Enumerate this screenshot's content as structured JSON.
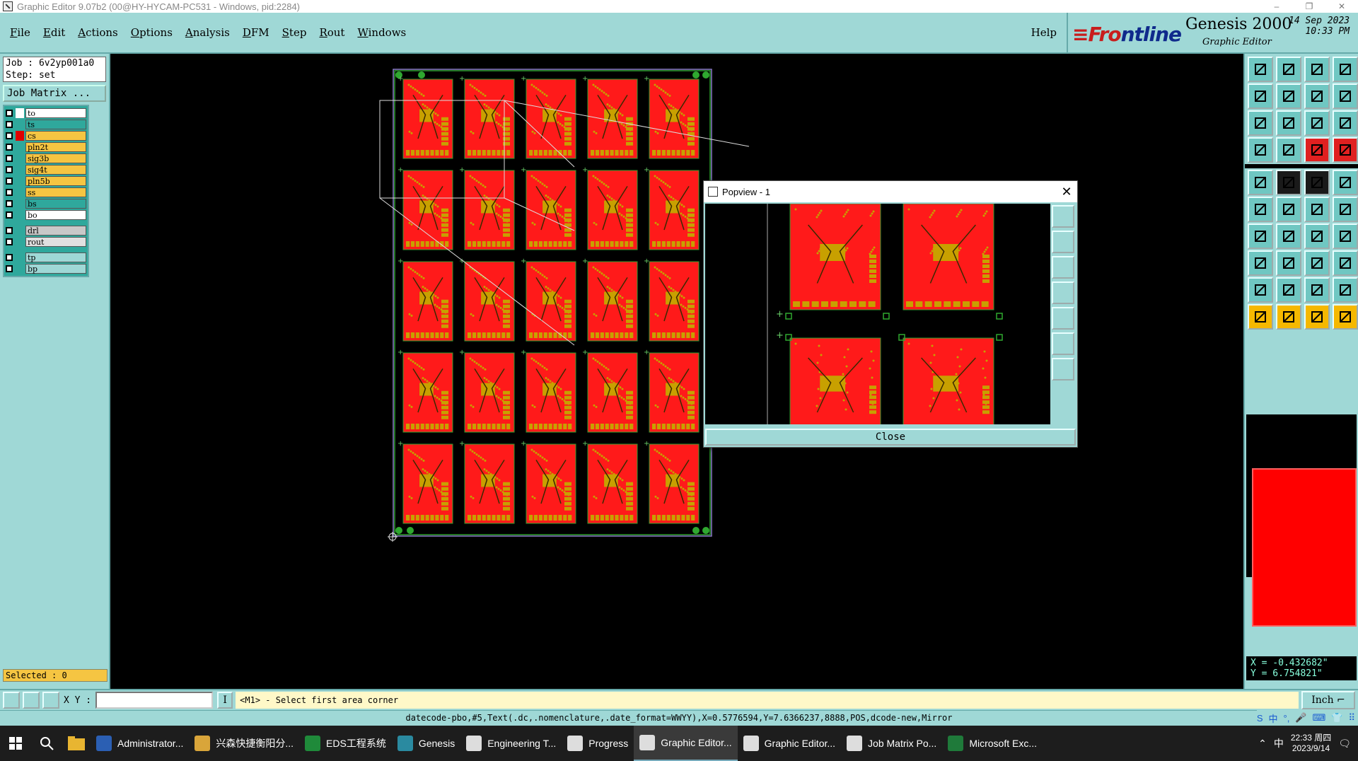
{
  "window": {
    "title": "Graphic Editor 9.07b2 (00@HY-HYCAM-PC531 - Windows, pid:2284)",
    "controls": [
      "–",
      "❐",
      "✕"
    ]
  },
  "menu": {
    "items": [
      "File",
      "Edit",
      "Actions",
      "Options",
      "Analysis",
      "DFM",
      "Step",
      "Rout",
      "Windows"
    ],
    "help": "Help"
  },
  "brand": {
    "logo_part1": "≡Fr",
    "logo_part2": "ntline",
    "logo_o": "o",
    "product": "Genesis 2000",
    "subtitle": "Graphic Editor",
    "date_line1": "14 Sep 2023",
    "date_line2": "10:33 PM"
  },
  "job": {
    "job_line": "Job : 6v2yp001a0",
    "step_line": "Step: set",
    "matrix_button": "Job Matrix ..."
  },
  "layers": [
    {
      "name": "to",
      "swatch": "#ffffff",
      "bg": "#ffffff",
      "active": false,
      "gap": false
    },
    {
      "name": "ts",
      "swatch": "#2fa89c",
      "bg": "#2fa89c",
      "active": false,
      "gap": false
    },
    {
      "name": "cs",
      "swatch": "#e00000",
      "bg": "#f5c542",
      "active": true,
      "gap": false
    },
    {
      "name": "pln2t",
      "swatch": "#2fa89c",
      "bg": "#f5c542",
      "active": false,
      "gap": false
    },
    {
      "name": "sig3b",
      "swatch": "#2fa89c",
      "bg": "#f5c542",
      "active": false,
      "gap": false
    },
    {
      "name": "sig4t",
      "swatch": "#2fa89c",
      "bg": "#f5c542",
      "active": false,
      "gap": false
    },
    {
      "name": "pln5b",
      "swatch": "#2fa89c",
      "bg": "#f5c542",
      "active": false,
      "gap": false
    },
    {
      "name": "ss",
      "swatch": "#2fa89c",
      "bg": "#f5c542",
      "active": false,
      "gap": false
    },
    {
      "name": "bs",
      "swatch": "#2fa89c",
      "bg": "#2fa89c",
      "active": false,
      "gap": false
    },
    {
      "name": "bo",
      "swatch": "#2fa89c",
      "bg": "#ffffff",
      "active": false,
      "gap": false
    },
    {
      "name": "drl",
      "swatch": "#2fa89c",
      "bg": "#c8c8c8",
      "active": false,
      "gap": true
    },
    {
      "name": "rout",
      "swatch": "#2fa89c",
      "bg": "#e0e0e0",
      "active": false,
      "gap": false
    },
    {
      "name": "tp",
      "swatch": "#2fa89c",
      "bg": "#9fd8d6",
      "active": false,
      "gap": true
    },
    {
      "name": "bp",
      "swatch": "#2fa89c",
      "bg": "#9fd8d6",
      "active": false,
      "gap": false
    }
  ],
  "selected": "Selected : 0",
  "coords": {
    "x": "X = -0.432682\"",
    "y": "Y = 6.754821\""
  },
  "command": {
    "xy_label": "X Y :",
    "input_value": "",
    "info_glyph": "I",
    "message": "<M1> - Select first area corner",
    "unit": "Inch ⌐"
  },
  "status_text": "datecode-pbo,#5,Text(.dc,.nomenclature,.date_format=WWYY),X=0.5776594,Y=7.6366237,8888,POS,dcode-new,Mirror",
  "ime": [
    "S",
    "中",
    "°,",
    "🎤",
    "⌨",
    "👕",
    "⠿"
  ],
  "popview": {
    "title": "Popview - 1",
    "close_glyph": "✕",
    "close_button": "Close"
  },
  "taskbar": {
    "apps": [
      {
        "label": "Administrator...",
        "color": "#2b5fb3",
        "active": false
      },
      {
        "label": "兴森快捷衡阳分...",
        "color": "#d9a53a",
        "active": false
      },
      {
        "label": "EDS工程系统",
        "color": "#1f8a3a",
        "active": false
      },
      {
        "label": "Genesis",
        "color": "#2a8aa0",
        "active": false
      },
      {
        "label": "Engineering T...",
        "color": "#dddddd",
        "active": false
      },
      {
        "label": "Progress",
        "color": "#dddddd",
        "active": false
      },
      {
        "label": "Graphic Editor...",
        "color": "#dddddd",
        "active": true
      },
      {
        "label": "Graphic Editor...",
        "color": "#dddddd",
        "active": false
      },
      {
        "label": "Job Matrix Po...",
        "color": "#dddddd",
        "active": false
      },
      {
        "label": "Microsoft Exc...",
        "color": "#1f7a3a",
        "active": false
      }
    ],
    "tray_lang": "中",
    "time": "22:33 周四",
    "date": "2023/9/14"
  },
  "colors": {
    "panel": "#9fd8d6",
    "pcb_red": "#ff1a1a",
    "pcb_copper": "#c8a000",
    "board_border": "#2e9e2e"
  }
}
